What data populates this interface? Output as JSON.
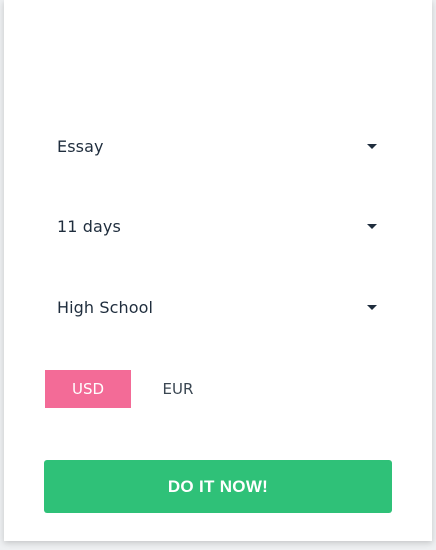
{
  "form": {
    "paper_type": {
      "selected": "Essay",
      "icon": "caret-down-icon"
    },
    "deadline": {
      "selected": "11 days",
      "icon": "caret-down-icon"
    },
    "academic_level": {
      "selected": "High School",
      "icon": "caret-down-icon"
    },
    "currency": {
      "options": [
        "USD",
        "EUR"
      ],
      "selected": "USD",
      "active_color": "#f36b97"
    },
    "submit_label": "DO IT NOW!",
    "submit_color": "#2fc178"
  }
}
